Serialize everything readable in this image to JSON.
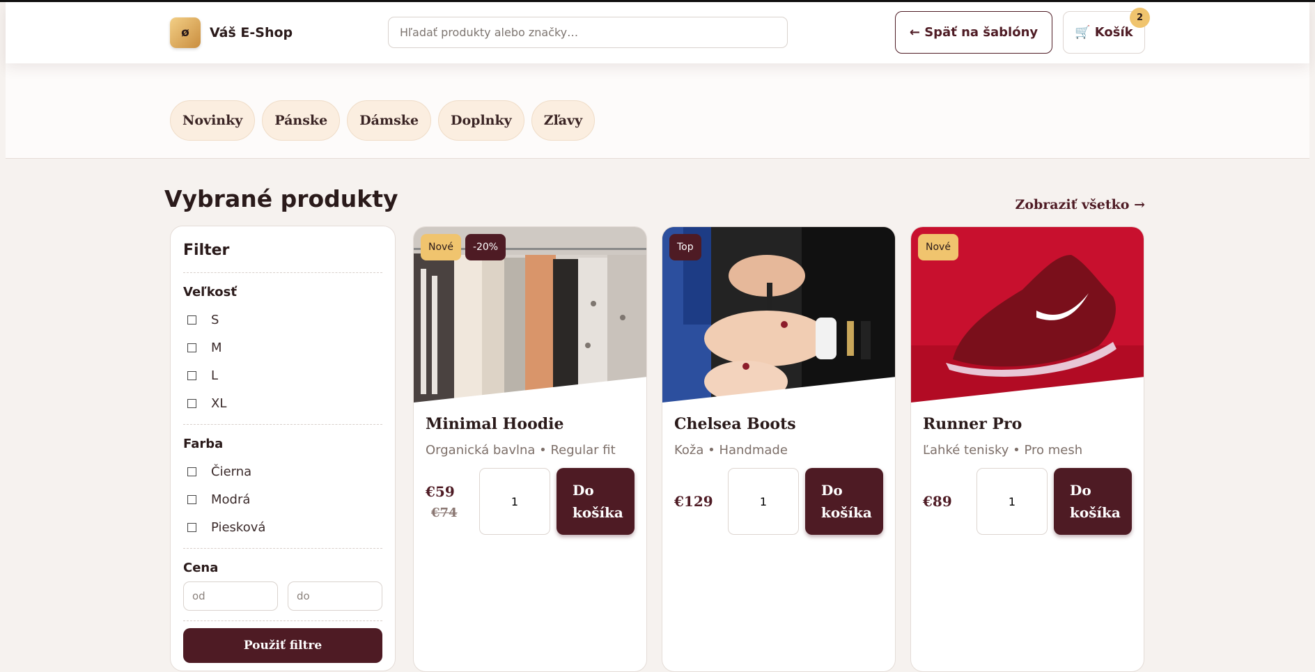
{
  "header": {
    "logo_glyph": "ø",
    "brand": "Váš E-Shop",
    "search_placeholder": "Hľadať produkty alebo značky…",
    "back_label": "← Späť na šablóny",
    "cart_icon": "🛒",
    "cart_label": "Košík",
    "cart_count": "2"
  },
  "nav": {
    "items": [
      "Novinky",
      "Pánske",
      "Dámske",
      "Doplnky",
      "Zľavy"
    ]
  },
  "section": {
    "title": "Vybrané produkty",
    "view_all": "Zobraziť všetko →"
  },
  "filter": {
    "title": "Filter",
    "size_label": "Veľkosť",
    "sizes": [
      "S",
      "M",
      "L",
      "XL"
    ],
    "color_label": "Farba",
    "colors": [
      "Čierna",
      "Modrá",
      "Piesková"
    ],
    "price_label": "Cena",
    "price_from_placeholder": "od",
    "price_to_placeholder": "do",
    "apply_label": "Použiť filtre"
  },
  "products": [
    {
      "badges": [
        "Nové",
        "-20%"
      ],
      "name": "Minimal Hoodie",
      "desc": "Organická bavlna • Regular fit",
      "price": "€59",
      "old_price": "€74",
      "qty": "1",
      "add_label": "Do košíka",
      "image_icon": "clothing-rack-photo"
    },
    {
      "badges": [
        "Top"
      ],
      "name": "Chelsea Boots",
      "desc": "Koža • Handmade",
      "price": "€129",
      "qty": "1",
      "add_label": "Do košíka",
      "image_icon": "manicure-photo"
    },
    {
      "badges": [
        "Nové"
      ],
      "name": "Runner Pro",
      "desc": "Ľahké tenisky • Pro mesh",
      "price": "€89",
      "qty": "1",
      "add_label": "Do košíka",
      "image_icon": "red-sneaker-photo"
    }
  ],
  "colors": {
    "accent": "#4e1b24",
    "gold": "#f0c46e",
    "pill_bg": "#fbeee0",
    "page_bg": "#f6f2ef"
  }
}
